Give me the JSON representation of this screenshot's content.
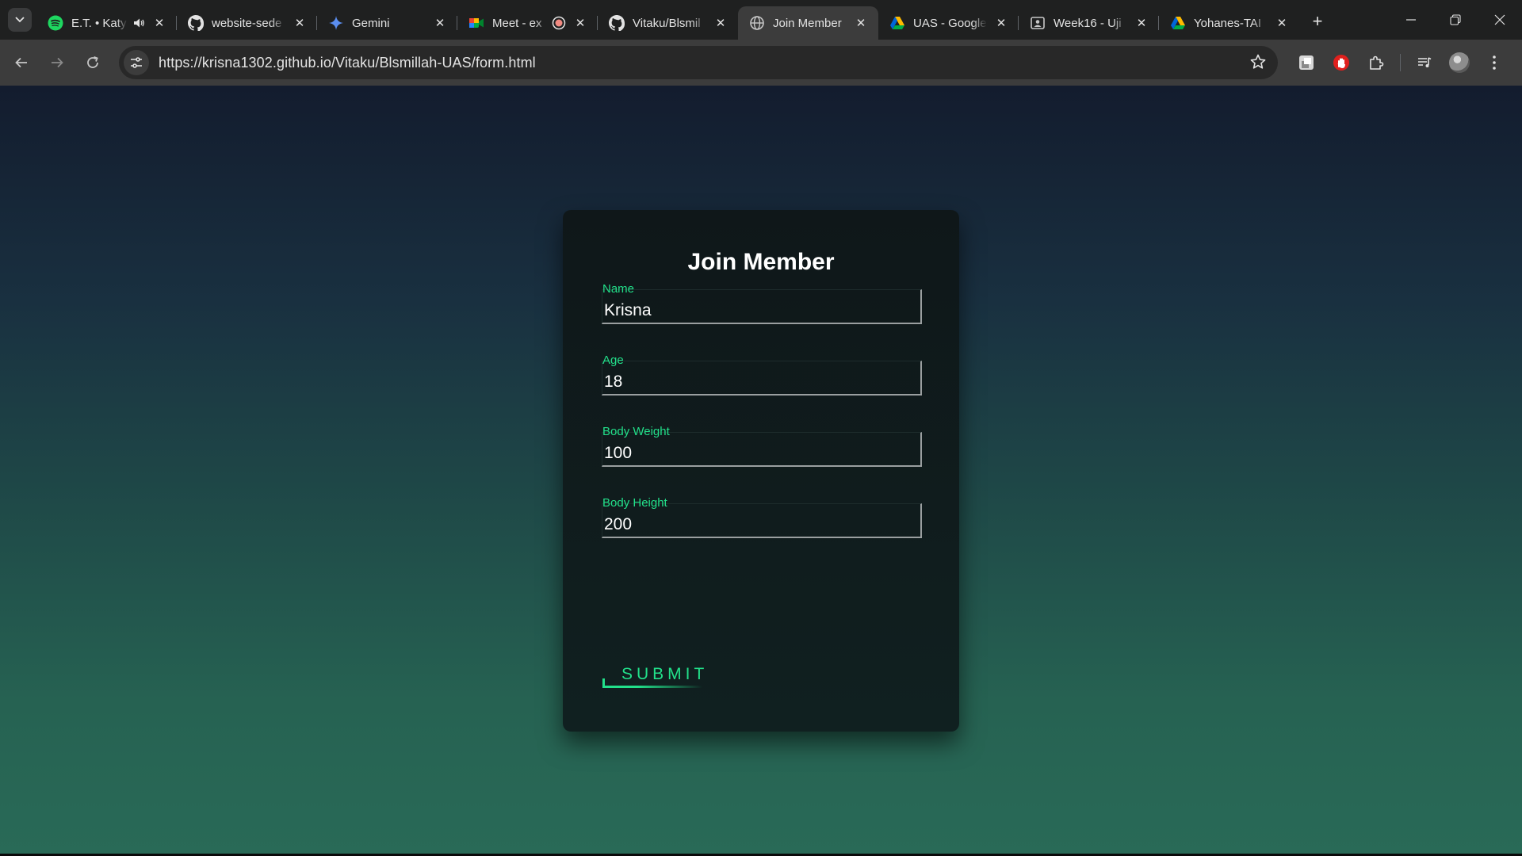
{
  "browser": {
    "tabs": [
      {
        "title": "E.T. • Katy",
        "favicon": "spotify-icon",
        "audio": true,
        "active": false
      },
      {
        "title": "website-sede",
        "favicon": "github-icon",
        "active": false
      },
      {
        "title": "Gemini",
        "favicon": "gemini-icon",
        "active": false
      },
      {
        "title": "Meet - ex",
        "favicon": "google-meet-icon",
        "recording": true,
        "active": false
      },
      {
        "title": "Vitaku/Blsmil",
        "favicon": "github-icon",
        "active": false
      },
      {
        "title": "Join Member",
        "favicon": "globe-icon",
        "active": true
      },
      {
        "title": "UAS - Google",
        "favicon": "google-drive-icon",
        "active": false
      },
      {
        "title": "Week16 - Uji",
        "favicon": "classroom-icon",
        "active": false
      },
      {
        "title": "Yohanes-TAI",
        "favicon": "google-drive-icon",
        "active": false
      }
    ],
    "url": "https://krisna1302.github.io/Vitaku/Blsmillah-UAS/form.html",
    "colors": {
      "tabstrip": "#1f2020",
      "toolbar": "#3c3c3c",
      "omnibox": "#282828"
    }
  },
  "form": {
    "title": "Join Member",
    "fields": [
      {
        "label": "Name",
        "value": "Krisna"
      },
      {
        "label": "Age",
        "value": "18"
      },
      {
        "label": "Body Weight",
        "value": "100"
      },
      {
        "label": "Body Height",
        "value": "200"
      }
    ],
    "submit_label": "SUBMIT",
    "colors": {
      "accent": "#22e08a",
      "card": "#0f1d1d",
      "text": "#ffffff"
    }
  }
}
